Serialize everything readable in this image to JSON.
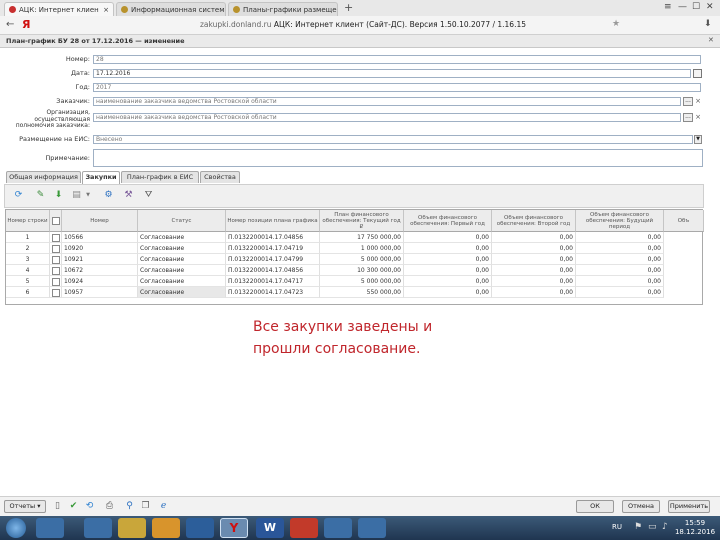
{
  "browser": {
    "tabs": [
      {
        "label": "АЦК: Интернет клиен",
        "active": true
      },
      {
        "label": "Информационная система",
        "active": false
      },
      {
        "label": "Планы-графики размещения",
        "active": false
      }
    ],
    "new_tab": "+",
    "close_tab": "×",
    "back_icon": "←",
    "logo": "Я",
    "address_domain": "zakupki.donland.ru",
    "address_title": "АЦК: Интернет клиент (Сайт-ДС). Версия 1.50.10.2077 / 1.16.15",
    "star_icon": "★",
    "window_controls": [
      "≡",
      "—",
      "☐",
      "✕"
    ],
    "download_icon": "⬇"
  },
  "doc": {
    "header_title": "План-график БУ 28 от 17.12.2016 — изменение",
    "header_close": "✕",
    "fields": [
      {
        "label": "Номер:",
        "value": "28"
      },
      {
        "label": "Дата:",
        "value": "17.12.2016"
      },
      {
        "label": "Год:",
        "value": "2017"
      },
      {
        "label": "Заказчик:",
        "value": "наименование заказчика ведомства Ростовской области"
      },
      {
        "label": "Организация, осуществляющая полномочия заказчика:",
        "value": "наименование заказчика ведомства Ростовской области"
      },
      {
        "label": "Размещение на ЕИС:",
        "value": "Внесено"
      },
      {
        "label": "Примечание:",
        "value": ""
      }
    ],
    "dots_label": "...",
    "tabs": [
      "Общая информация",
      "Закупки",
      "План-график в ЕИС",
      "Свойства"
    ],
    "active_tab": 1
  },
  "grid": {
    "headers": [
      "Номер строки",
      "",
      "Номер",
      "Статус",
      "Номер позиции плана графика",
      "План финансового обеспечения: Текущий год ₽",
      "Объем финансового обеспечения: Первый год",
      "Объем финансового обеспечения: Второй год",
      "Объем финансового обеспечения: Будущий период",
      "Объ"
    ],
    "rows": [
      [
        "1",
        "",
        "10566",
        "Согласование",
        "П.0132200014.17.04856",
        "17 750 000,00",
        "0,00",
        "0,00",
        "0,00"
      ],
      [
        "2",
        "",
        "10920",
        "Согласование",
        "П.0132200014.17.04719",
        "1 000 000,00",
        "0,00",
        "0,00",
        "0,00"
      ],
      [
        "3",
        "",
        "10921",
        "Согласование",
        "П.0132200014.17.04799",
        "5 000 000,00",
        "0,00",
        "0,00",
        "0,00"
      ],
      [
        "4",
        "",
        "10672",
        "Согласование",
        "П.0132200014.17.04856",
        "10 300 000,00",
        "0,00",
        "0,00",
        "0,00"
      ],
      [
        "5",
        "",
        "10924",
        "Согласование",
        "П.0132200014.17.04717",
        "5 000 000,00",
        "0,00",
        "0,00",
        "0,00"
      ],
      [
        "6",
        "",
        "10957",
        "Согласование",
        "П.0132200014.17.04723",
        "550 000,00",
        "0,00",
        "0,00",
        "0,00"
      ]
    ]
  },
  "annotation": {
    "line1": "Все закупки заведены и",
    "line2": "прошли согласование."
  },
  "bottom": {
    "report_label": "Отчеты",
    "ok_label": "ОК",
    "cancel_label": "Отмена",
    "apply_label": "Применить"
  },
  "taskbar": {
    "time": "15:59",
    "date": "18.12.2016",
    "lang": "RU"
  },
  "colors": {
    "annotation": "#c0262c",
    "taskbar": "#2b4563",
    "grid_header": "#ececec"
  }
}
